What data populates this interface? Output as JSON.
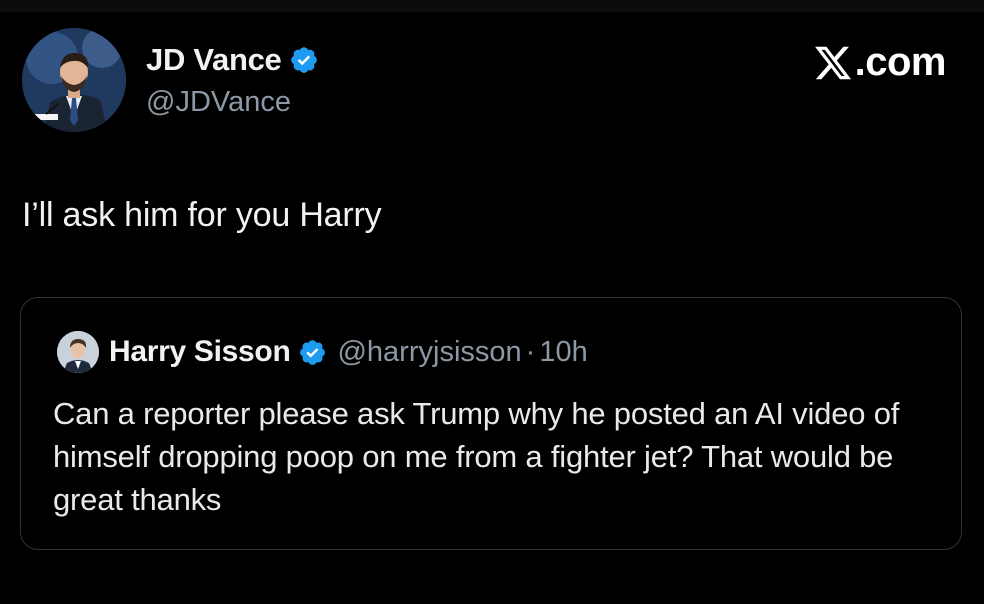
{
  "brand": {
    "label": ".com",
    "icon": "x-logo-icon"
  },
  "author": {
    "name": "JD Vance",
    "handle": "@JDVance",
    "verified": true,
    "verified_color": "#1d9bf0",
    "avatar_icon": "profile-photo"
  },
  "tweet": {
    "text": "I’ll ask him for you Harry"
  },
  "quoted_tweet": {
    "author_name": "Harry Sisson",
    "handle": "@harryjsisson",
    "separator": "·",
    "time": "10h",
    "verified": true,
    "text": "Can a reporter please ask Trump why he posted an AI video of himself dropping poop on me from a fighter jet? That would be great thanks"
  },
  "colors": {
    "background": "#000000",
    "text_primary": "#e7e9ea",
    "text_secondary": "#8b98a5",
    "border": "#2f3336",
    "verified_blue": "#1d9bf0"
  }
}
